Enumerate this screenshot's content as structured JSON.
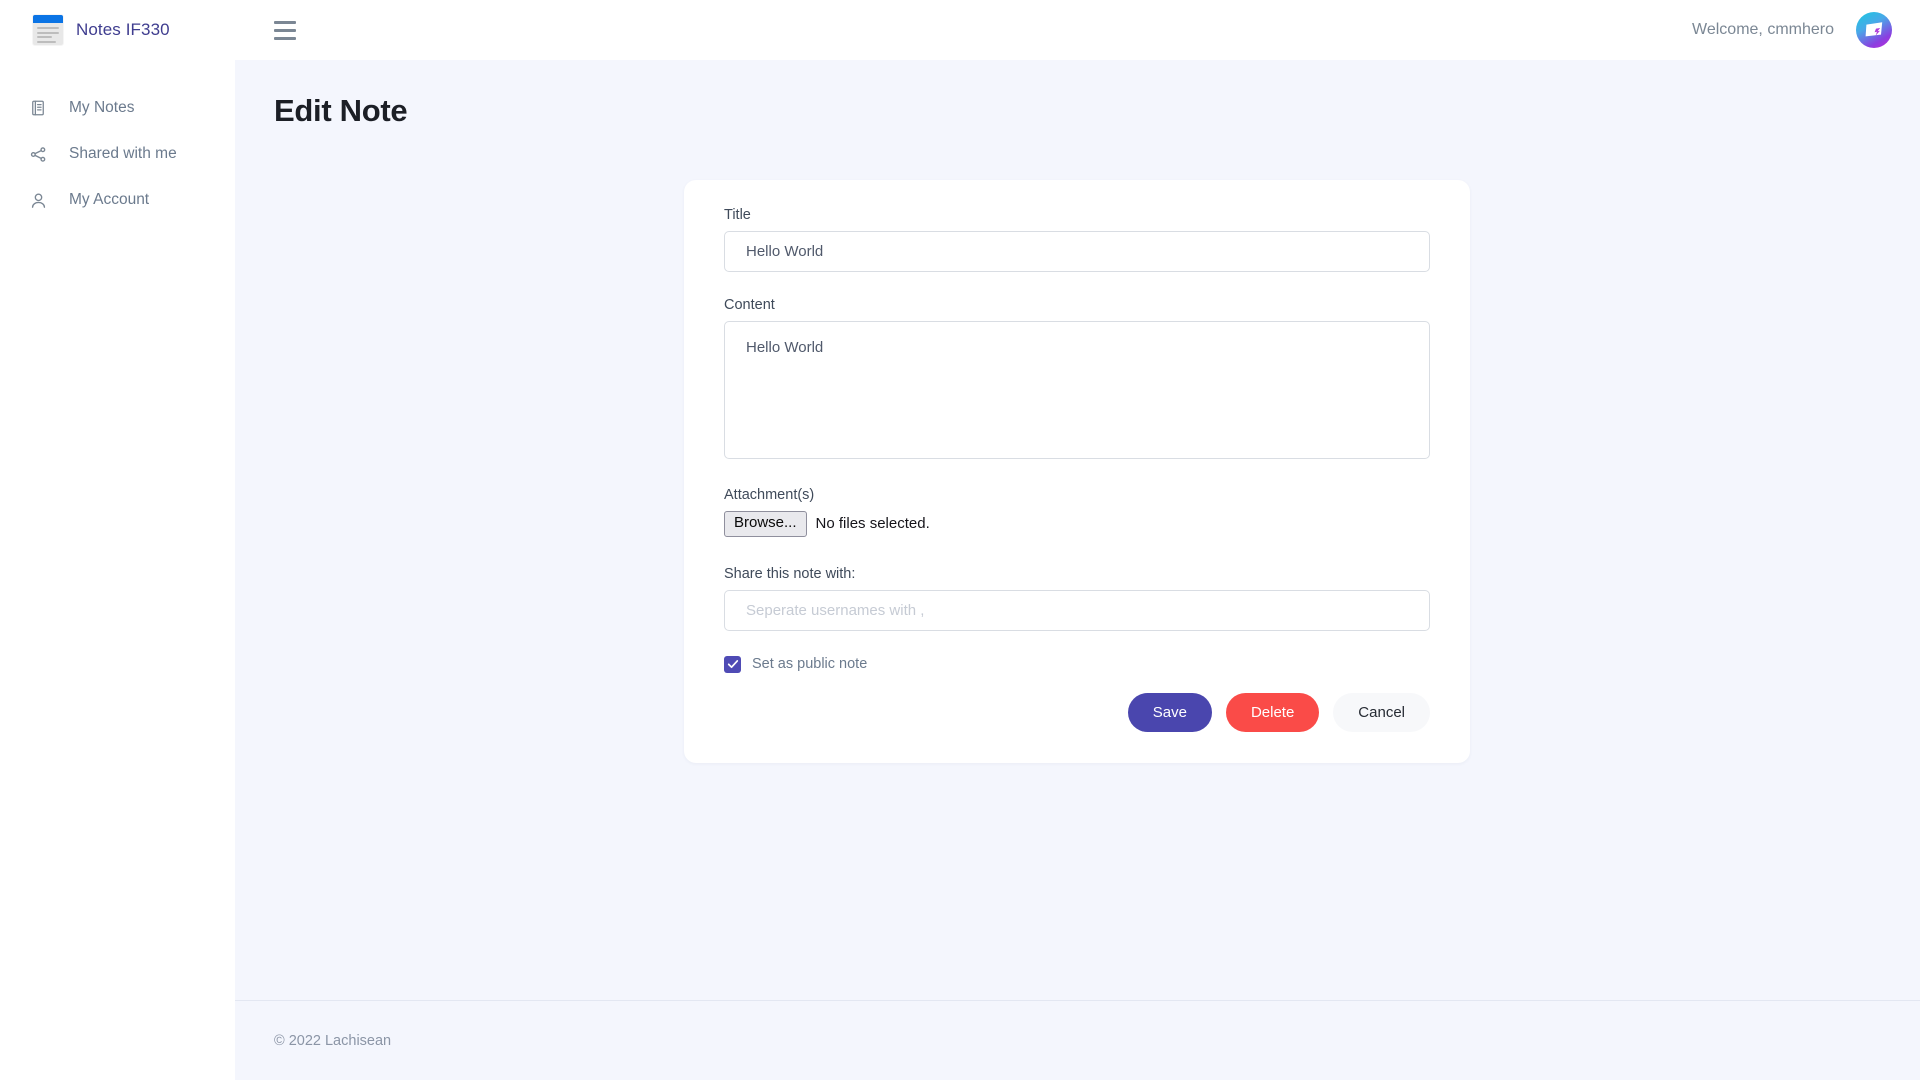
{
  "navbar": {
    "brand_name": "Notes IF330",
    "brand_logo_icon": "notes-document-icon",
    "menu_icon": "hamburger-menu-icon",
    "welcome_text": "Welcome, cmmhero",
    "avatar_icon": "user-avatar-screen-bolt-icon"
  },
  "sidebar": {
    "items": [
      {
        "label": "My Notes",
        "icon": "notes-list-icon"
      },
      {
        "label": "Shared with me",
        "icon": "share-nodes-icon"
      },
      {
        "label": "My Account",
        "icon": "user-person-icon"
      }
    ]
  },
  "main": {
    "page_title": "Edit Note"
  },
  "form": {
    "title_label": "Title",
    "title_value": "Hello World",
    "title_placeholder": "",
    "content_label": "Content",
    "content_value": "Hello World",
    "content_placeholder": "",
    "attachments_label": "Attachment(s)",
    "browse_button_label": "Browse...",
    "file_status_text": "No files selected.",
    "share_label": "Share this note with:",
    "share_value": "",
    "share_placeholder": "Seperate usernames with ,",
    "public_note_label": "Set as public note",
    "public_note_checked": true,
    "check_icon": "checkmark-icon",
    "save_label": "Save",
    "delete_label": "Delete",
    "cancel_label": "Cancel"
  },
  "footer": {
    "copyright": "© 2022 Lachisean"
  },
  "colors": {
    "brand_text": "#3f3d8f",
    "logo_blue": "#0b74e5",
    "page_background": "#f4f6fd",
    "card_background": "#ffffff",
    "save_button": "#4a46ae",
    "delete_button": "#fa4b48",
    "cancel_button": "#f7f8fa",
    "checkbox_fill": "#4f4bb5",
    "muted_text": "#7b8794"
  }
}
